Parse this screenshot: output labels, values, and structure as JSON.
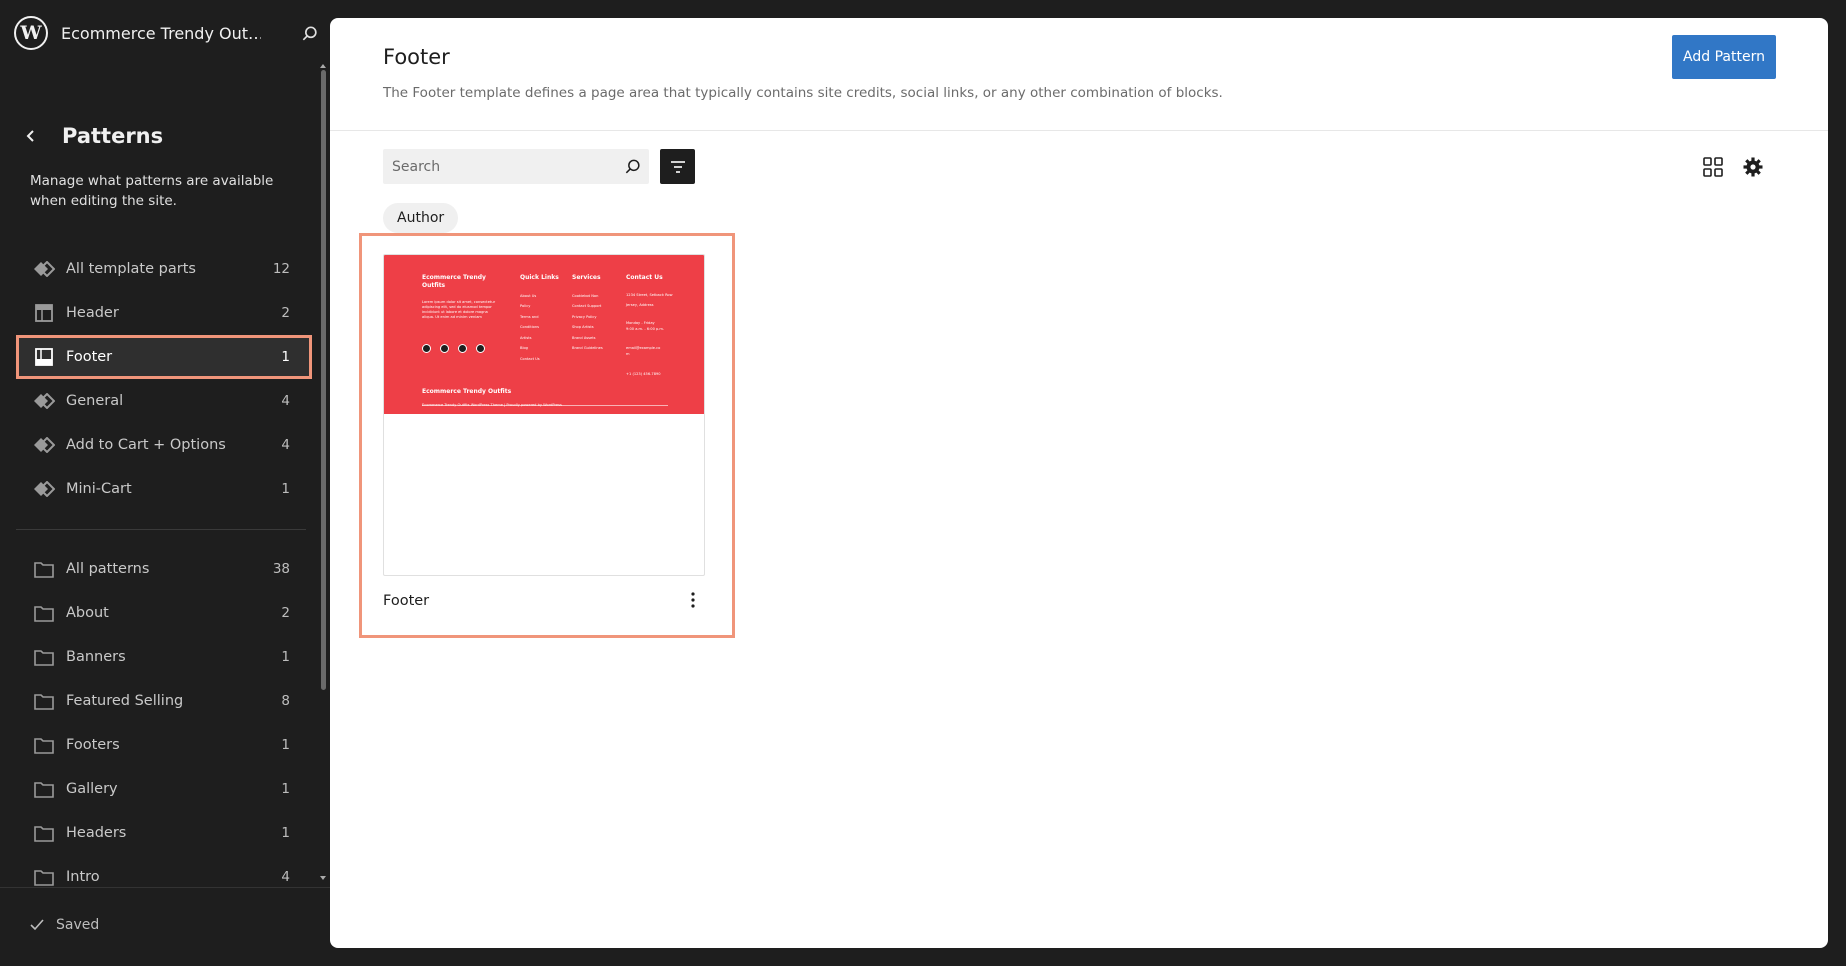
{
  "site": {
    "title": "Ecommerce Trendy Out…"
  },
  "nav": {
    "title": "Patterns",
    "description": "Manage what patterns are available when editing the site.",
    "template_parts": [
      {
        "label": "All template parts",
        "count": "12",
        "icon": "symbol-icon"
      },
      {
        "label": "Header",
        "count": "2",
        "icon": "header-icon"
      },
      {
        "label": "Footer",
        "count": "1",
        "icon": "footer-icon",
        "active": true
      },
      {
        "label": "General",
        "count": "4",
        "icon": "symbol-icon"
      },
      {
        "label": "Add to Cart + Options",
        "count": "4",
        "icon": "symbol-icon"
      },
      {
        "label": "Mini-Cart",
        "count": "1",
        "icon": "symbol-icon"
      }
    ],
    "pattern_categories": [
      {
        "label": "All patterns",
        "count": "38"
      },
      {
        "label": "About",
        "count": "2"
      },
      {
        "label": "Banners",
        "count": "1"
      },
      {
        "label": "Featured Selling",
        "count": "8"
      },
      {
        "label": "Footers",
        "count": "1"
      },
      {
        "label": "Gallery",
        "count": "1"
      },
      {
        "label": "Headers",
        "count": "1"
      },
      {
        "label": "Intro",
        "count": "4"
      }
    ],
    "saved_label": "Saved"
  },
  "main": {
    "title": "Footer",
    "description": "The Footer template defines a page area that typically contains site credits, social links, or any other combination of blocks.",
    "add_button": "Add Pattern",
    "search_placeholder": "Search",
    "author_filter": "Author",
    "card": {
      "title": "Footer",
      "preview": {
        "site_name": "Ecommerce Trendy Outfits",
        "about_text": "Lorem ipsum dolor sit amet, consectetur adipiscing elit, sed do eiusmod tempor incididunt ut labore et dolore magna aliqua. Ut enim ad minim veniam",
        "col_quick_links": "Quick Links",
        "quick_links": [
          "About Us",
          "Policy",
          "Terms and",
          "Conditions",
          "Artists",
          "Blog",
          "Contact Us"
        ],
        "col_services": "Services",
        "services": [
          "Cookiebot Non",
          "Contact Support",
          "Privacy Policy",
          "Shop Artists",
          "Brand Assets",
          "Brand Guidelines"
        ],
        "col_contact": "Contact Us",
        "contact_lines": [
          "1234 Street, Setback Row",
          "Jersey, Address",
          "Monday - Friday",
          "9:00 a.m. - 6:00 p.m.",
          "email@example.co",
          "m",
          "+1 (123) 456-7890"
        ],
        "bottom_title": "Ecommerce Trendy Outfits",
        "copyright": "Ecommerce Trendy Outfits WordPress Theme | Proudly powered by WordPress"
      }
    }
  },
  "colors": {
    "sidebar_bg": "#1e1e1e",
    "accent": "#3177c6",
    "highlight": "#f0957a",
    "preview_red": "#ee3f47"
  }
}
